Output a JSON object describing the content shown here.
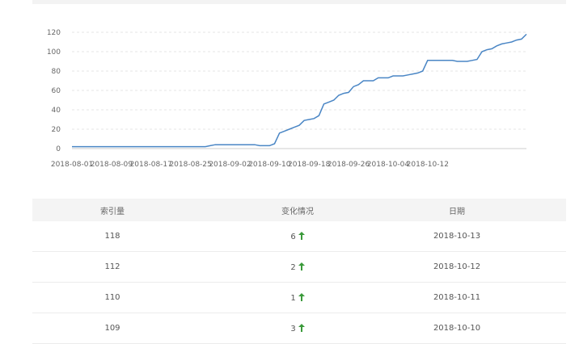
{
  "chart_data": {
    "type": "line",
    "x_labels": [
      "2018-08-01",
      "2018-08-09",
      "2018-08-17",
      "2018-08-25",
      "2018-09-02",
      "2018-09-10",
      "2018-09-18",
      "2018-09-26",
      "2018-10-04",
      "2018-10-12"
    ],
    "y_ticks": [
      0,
      20,
      40,
      60,
      80,
      100,
      120
    ],
    "ylim": [
      0,
      120
    ],
    "grid": true,
    "series_color": "#4a86c5",
    "series": [
      {
        "values": [
          2,
          2,
          2,
          2,
          2,
          2,
          2,
          2,
          2,
          2,
          2,
          2,
          2,
          2,
          2,
          2,
          2,
          2,
          2,
          2,
          2,
          2,
          2,
          2,
          2,
          2,
          2,
          2,
          3,
          4,
          4,
          4,
          4,
          4,
          4,
          4,
          4,
          4,
          3,
          3,
          3,
          5,
          16,
          18,
          20,
          22,
          24,
          29,
          30,
          31,
          34,
          46,
          48,
          50,
          55,
          57,
          58,
          64,
          66,
          70,
          70,
          70,
          73,
          73,
          73,
          75,
          75,
          75,
          76,
          77,
          78,
          80,
          91,
          91,
          91,
          91,
          91,
          91,
          90,
          90,
          90,
          91,
          92,
          100,
          102,
          103,
          106,
          108,
          109,
          110,
          112,
          113,
          118
        ]
      }
    ]
  },
  "table": {
    "headers": [
      "索引量",
      "变化情况",
      "日期"
    ],
    "rows": [
      {
        "count": "118",
        "change": "6",
        "date": "2018-10-13"
      },
      {
        "count": "112",
        "change": "2",
        "date": "2018-10-12"
      },
      {
        "count": "110",
        "change": "1",
        "date": "2018-10-11"
      },
      {
        "count": "109",
        "change": "3",
        "date": "2018-10-10"
      }
    ],
    "arrow_color": "#3a9a3a"
  }
}
